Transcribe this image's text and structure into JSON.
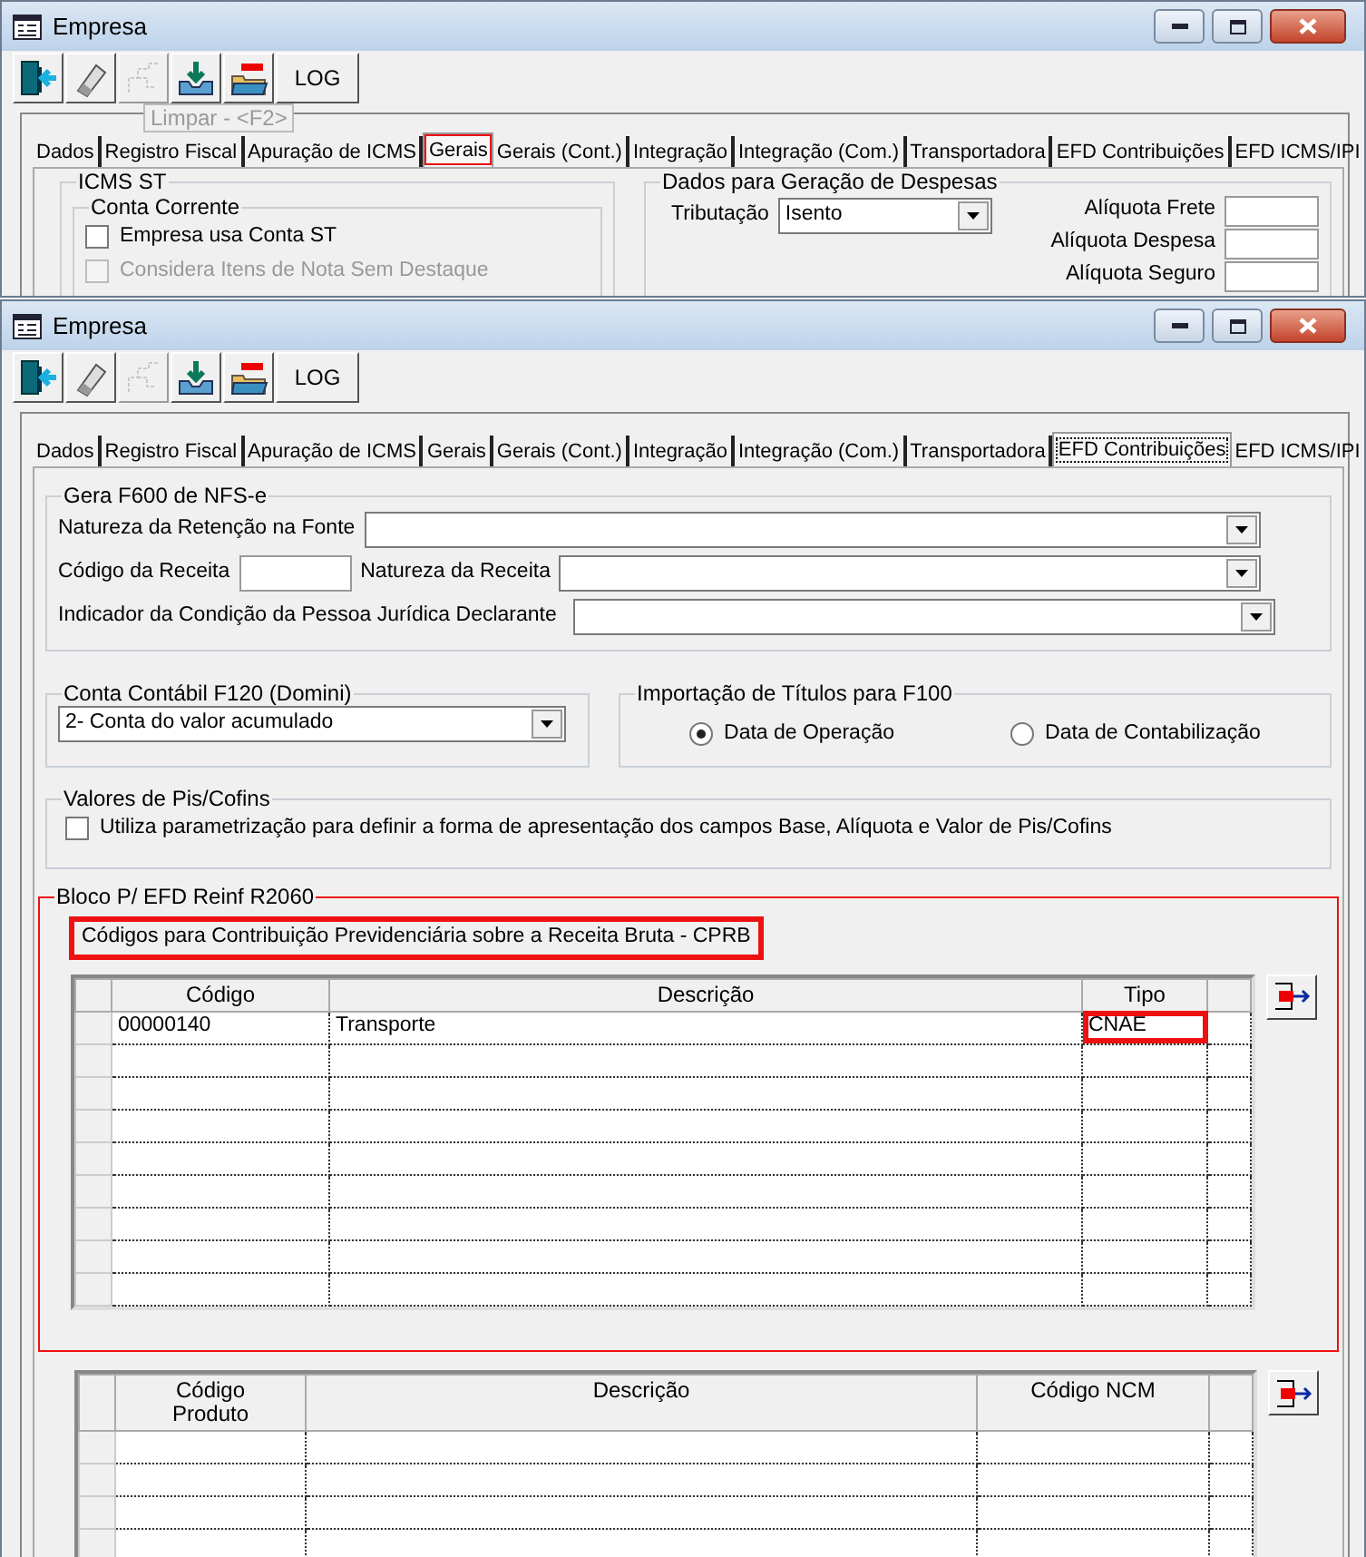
{
  "windows": [
    {
      "title": "Empresa",
      "toolbar": [
        {
          "kind": "exit",
          "disabled": false
        },
        {
          "kind": "eraser",
          "disabled": false
        },
        {
          "kind": "tree",
          "disabled": true
        },
        {
          "kind": "save",
          "disabled": false
        },
        {
          "kind": "delete",
          "disabled": false
        },
        {
          "kind": "text",
          "label": "LOG",
          "disabled": false
        }
      ],
      "tooltip": "Limpar - <F2>",
      "tabs": [
        {
          "label": "Dados",
          "selected": false,
          "highlighted": false
        },
        {
          "label": "Registro Fiscal",
          "selected": false,
          "highlighted": false
        },
        {
          "label": "Apuração de ICMS",
          "selected": false,
          "highlighted": false
        },
        {
          "label": "Gerais",
          "selected": true,
          "highlighted": true
        },
        {
          "label": "Gerais (Cont.)",
          "selected": false,
          "highlighted": false
        },
        {
          "label": "Integração",
          "selected": false,
          "highlighted": false
        },
        {
          "label": "Integração (Com.)",
          "selected": false,
          "highlighted": false
        },
        {
          "label": "Transportadora",
          "selected": false,
          "highlighted": false
        },
        {
          "label": "EFD Contribuições",
          "selected": false,
          "highlighted": false
        },
        {
          "label": "EFD ICMS/IPI",
          "selected": false,
          "highlighted": false
        }
      ],
      "content": {
        "kind": "gerais",
        "icms_st": {
          "title": "ICMS ST",
          "conta_corrente": {
            "title": "Conta Corrente",
            "options": [
              {
                "label": "Empresa usa Conta ST",
                "checked": false,
                "disabled": false
              },
              {
                "label": "Considera Itens de Nota Sem Destaque",
                "checked": false,
                "disabled": true
              }
            ]
          }
        },
        "despesas": {
          "title": "Dados para Geração de Despesas",
          "tributacao": {
            "label": "Tributação",
            "value": "Isento"
          },
          "rates": [
            {
              "label": "Alíquota Frete"
            },
            {
              "label": "Alíquota Despesa"
            },
            {
              "label": "Alíquota Seguro"
            }
          ]
        }
      }
    },
    {
      "title": "Empresa",
      "toolbar": [
        {
          "kind": "exit",
          "disabled": false
        },
        {
          "kind": "eraser",
          "disabled": false
        },
        {
          "kind": "tree",
          "disabled": true
        },
        {
          "kind": "save",
          "disabled": false
        },
        {
          "kind": "delete",
          "disabled": false
        },
        {
          "kind": "text",
          "label": "LOG",
          "disabled": false
        }
      ],
      "tabs": [
        {
          "label": "Dados",
          "selected": false,
          "highlighted": false
        },
        {
          "label": "Registro Fiscal",
          "selected": false,
          "highlighted": false
        },
        {
          "label": "Apuração de ICMS",
          "selected": false,
          "highlighted": false
        },
        {
          "label": "Gerais",
          "selected": false,
          "highlighted": false
        },
        {
          "label": "Gerais (Cont.)",
          "selected": false,
          "highlighted": false
        },
        {
          "label": "Integração",
          "selected": false,
          "highlighted": false
        },
        {
          "label": "Integração (Com.)",
          "selected": false,
          "highlighted": false
        },
        {
          "label": "Transportadora",
          "selected": false,
          "highlighted": false
        },
        {
          "label": "EFD Contribuições",
          "selected": true,
          "highlighted": false
        },
        {
          "label": "EFD ICMS/IPI",
          "selected": false,
          "highlighted": false
        }
      ],
      "content": {
        "kind": "efd",
        "f600": {
          "title": "Gera F600 de NFS-e",
          "natureza_retencao": {
            "label": "Natureza da Retenção na Fonte"
          },
          "codigo_receita": {
            "label": "Código da Receita"
          },
          "natureza_receita": {
            "label": "Natureza da Receita"
          },
          "indicador": {
            "label": "Indicador da Condição da Pessoa Jurídica Declarante"
          }
        },
        "f120": {
          "title": "Conta Contábil F120 (Domini)",
          "value": "2- Conta do valor acumulado"
        },
        "f100": {
          "title": "Importação de Títulos para F100",
          "options": [
            {
              "label": "Data de Operação",
              "selected": true
            },
            {
              "label": "Data de Contabilização",
              "selected": false
            }
          ]
        },
        "pis_cofins": {
          "title": "Valores de Pis/Cofins",
          "option": {
            "label": "Utiliza parametrização para definir a forma de apresentação dos campos Base, Alíquota e Valor de Pis/Cofins",
            "checked": false
          }
        },
        "reinf": {
          "title": "Bloco P/ EFD Reinf R2060",
          "highlighted": true,
          "caption": {
            "text": "Códigos para Contribuição Previdenciária sobre a Receita Bruta - CPRB",
            "highlighted": true
          },
          "grid": {
            "columns": [
              "Código",
              "Descrição",
              "Tipo"
            ],
            "rows": [
              {
                "cells": [
                  {
                    "text": "00000140",
                    "highlighted": false
                  },
                  {
                    "text": "Transporte",
                    "highlighted": false
                  },
                  {
                    "text": "CNAE",
                    "highlighted": true
                  }
                ]
              }
            ]
          }
        },
        "products_grid": {
          "columns": [
            "Código\nProduto",
            "Descrição",
            "Código NCM"
          ]
        }
      }
    }
  ]
}
